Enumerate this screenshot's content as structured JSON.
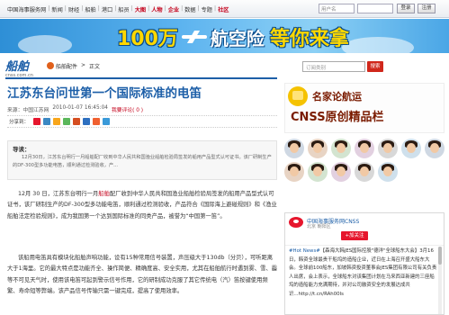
{
  "topnav": {
    "items": [
      {
        "label": "中国海事服务网",
        "red": false
      },
      {
        "label": "新闻",
        "red": false
      },
      {
        "label": "财经",
        "red": false
      },
      {
        "label": "船舶",
        "red": false
      },
      {
        "label": "港口",
        "red": false
      },
      {
        "label": "船员",
        "red": false
      },
      {
        "label": "大图",
        "red": true
      },
      {
        "label": "人物",
        "red": true
      },
      {
        "label": "企业",
        "red": true
      },
      {
        "label": "数据",
        "red": false
      },
      {
        "label": "专题",
        "red": false
      },
      {
        "label": "社区",
        "red": true
      }
    ],
    "username_placeholder": "用户名",
    "login_label": "登录",
    "register_label": "注册"
  },
  "banner": {
    "part1": "100万",
    "part2": "航空险",
    "part3": "等你来拿"
  },
  "logo": {
    "name": "船舶",
    "url": "cnss.com.cn"
  },
  "breadcrumb": {
    "section": "船舶配件",
    "current": "正文"
  },
  "search": {
    "placeholder": "订阅类别",
    "button": "搜索"
  },
  "article": {
    "title": "江苏东台问世第一个国际标准的电笛",
    "source": "来源：中国江苏网",
    "time": "2010-01-07 16:45:04",
    "comments": "我要评论( 0 )",
    "share_label": "分享到：",
    "share_icons": [
      "#e6162d",
      "#3b88c3",
      "#f8a61c",
      "#5bb75b",
      "#d54e21",
      "#2d6fbf",
      "#f06030",
      "#3a9ad9"
    ],
    "intro_title": "导读：",
    "intro_text": "12月30日，江苏东台明行一月船舶配厂收到中华人民共和国渔业船舶检验局签发的船用产品型式认可证书。该厂研制生产的DF-300型多功能电笛，顺利通过检测验收，产...",
    "para1_pre": "12月 30 日，江苏东台明行一月",
    "para1_hl": "船舶",
    "para1_post": "配厂收到中华人民共和国渔业船舶检验局签发的船用产品型式认可证书，该厂研制生产的DF-300型多功能电笛，顺利通过检测验收，产品符合《国际海上避碰规则》和《渔业船舶法定检验规则》，成为我国第一个达到国际标准的同类产品，被誉为“中国第一笛”。",
    "para2": "该船用电笛具有模块化船舶声响功能，设有15种常用信号装置，声压级大于130db（分贝），可听距离大于1海里。它的最大特点是功能齐全、操作简便、精确度高、安全实用，尤其在船舶航行时遇到雾、雪、霾等不可见天气时，使用该电笛可起到警示信号作用，它的研制成功克服了其它传统电（汽）笛按键使用频繁、寿命短等弊端。该产品信号传输只需一键完成，提高了使用效率。"
  },
  "ad": {
    "line1": "名家论航运",
    "line2": "CNSS原创精品栏"
  },
  "avatars_count": 12,
  "weibo": {
    "name": "中国海事服务网CNSS",
    "location": "北京 朝阳区",
    "follow": "+加关注",
    "hashtag": "#Hot News#",
    "text": "【森海大韩JES国际控股\"德洋\"全球船东大会】3月16日，韩资全球最贵干船坞的造船企业，近日在上海召开盛大船东大会。全球前100船东，加坡韩资投资董事会JES集团有限公司有关负责人出席，会上表示，全球船东对该集团计划在马来西亚新建的三座船坞的造船能力充满期待，并对公司融资安全的发展达成共识...http://t.cn/RAh00Is"
  }
}
